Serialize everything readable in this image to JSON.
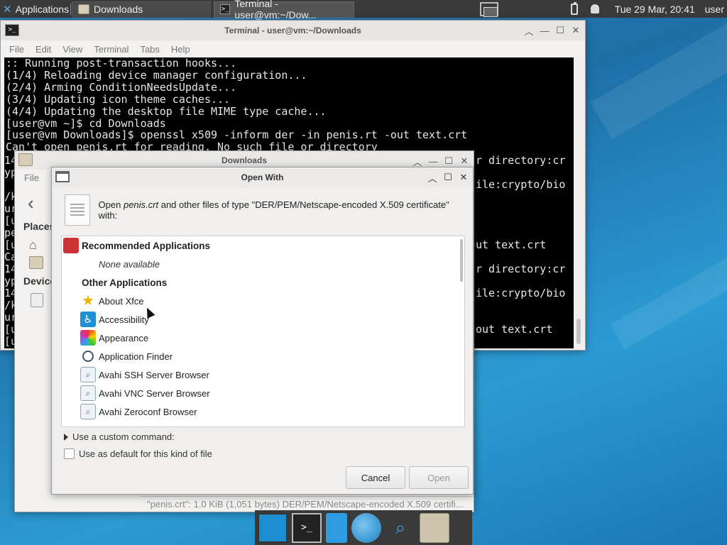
{
  "top_panel": {
    "applications_label": "Applications",
    "tasks": [
      {
        "label": "Downloads",
        "icon": "folder-icon"
      },
      {
        "label": "Terminal - user@vm:~/Dow...",
        "icon": "terminal-icon"
      }
    ],
    "clock": "Tue 29 Mar, 20:41",
    "user": "user"
  },
  "terminal": {
    "title": "Terminal - user@vm:~/Downloads",
    "menu": [
      "File",
      "Edit",
      "View",
      "Terminal",
      "Tabs",
      "Help"
    ],
    "lines": [
      ":: Running post-transaction hooks...",
      "(1/4) Reloading device manager configuration...",
      "(2/4) Arming ConditionNeedsUpdate...",
      "(3/4) Updating icon theme caches...",
      "(4/4) Updating the desktop file MIME type cache...",
      "[user@vm ~]$ cd Downloads",
      "[user@vm Downloads]$ openssl x509 -inform der -in penis.rt -out text.crt",
      "Can't open penis.rt for reading, No such file or directory"
    ],
    "visible_fragments": [
      "r directory:cr",
      "ile:crypto/bio",
      "ut text.crt",
      "r directory:cr",
      "ile:crypto/bio",
      "out text.crt"
    ],
    "left_fragments": [
      "14",
      "yp",
      "/k",
      "ur",
      "[u",
      "pe",
      "[u",
      "Ca",
      "14",
      "yp",
      "14",
      "/k",
      "ur",
      "[u",
      "[u"
    ]
  },
  "downloads": {
    "title": "Downloads",
    "menu_file": "File",
    "sidebar_places": "Places",
    "sidebar_devices": "Device",
    "status": "\"penis.crt\": 1.0 KiB (1,051 bytes) DER/PEM/Netscape-encoded X.509 certifi..."
  },
  "open_with": {
    "title": "Open With",
    "header_prefix": "Open ",
    "header_file": "penis.crt",
    "header_suffix": " and other files of type \"DER/PEM/Netscape-encoded X.509 certificate\" with:",
    "recommended_label": "Recommended Applications",
    "none_available": "None available",
    "other_label": "Other Applications",
    "apps": [
      {
        "name": "About Xfce",
        "icon": "star-icon"
      },
      {
        "name": "Accessibility",
        "icon": "accessibility-icon"
      },
      {
        "name": "Appearance",
        "icon": "appearance-icon"
      },
      {
        "name": "Application Finder",
        "icon": "finder-icon"
      },
      {
        "name": "Avahi SSH Server Browser",
        "icon": "avahi-icon"
      },
      {
        "name": "Avahi VNC Server Browser",
        "icon": "avahi-icon"
      },
      {
        "name": "Avahi Zeroconf Browser",
        "icon": "avahi-icon"
      }
    ],
    "custom_command": "Use a custom command:",
    "default_checkbox": "Use as default for this kind of file",
    "cancel": "Cancel",
    "open": "Open"
  },
  "dock": {
    "items": [
      "desktop-icon",
      "terminal-icon",
      "phone-icon",
      "web-browser-icon",
      "app-finder-icon",
      "file-manager-icon"
    ]
  }
}
